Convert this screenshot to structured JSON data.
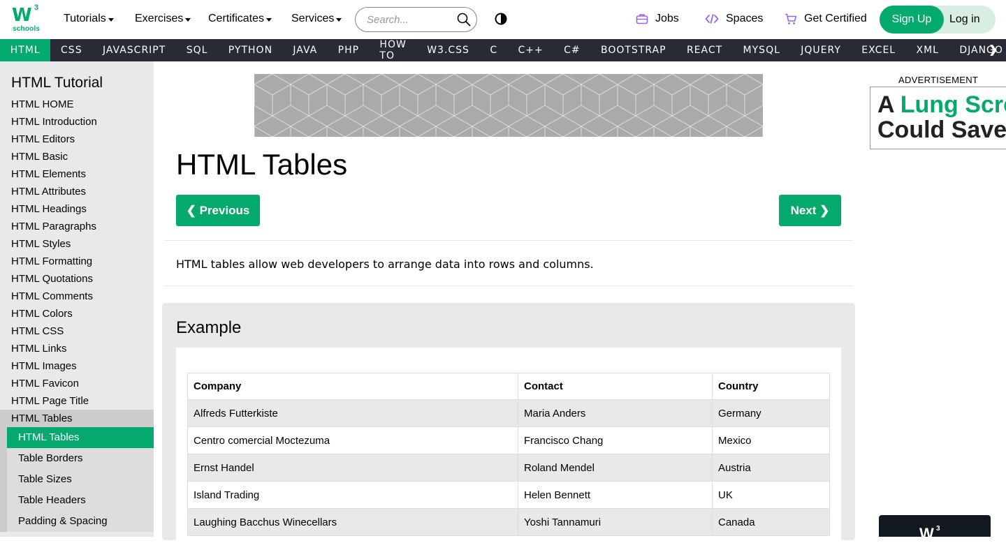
{
  "logo": {
    "main": "W",
    "sup": "3",
    "sub": "schools"
  },
  "topnav": {
    "tutorials": "Tutorials",
    "exercises": "Exercises",
    "certificates": "Certificates",
    "services": "Services",
    "search_placeholder": "Search...",
    "jobs": "Jobs",
    "spaces": "Spaces",
    "get_certified": "Get Certified",
    "sign_up": "Sign Up",
    "log_in": "Log in"
  },
  "subnav": [
    "HTML",
    "CSS",
    "JAVASCRIPT",
    "SQL",
    "PYTHON",
    "JAVA",
    "PHP",
    "HOW TO",
    "W3.CSS",
    "C",
    "C++",
    "C#",
    "BOOTSTRAP",
    "REACT",
    "MYSQL",
    "JQUERY",
    "EXCEL",
    "XML",
    "DJANGO"
  ],
  "subnav_more": "❯",
  "sidebar": {
    "title": "HTML Tutorial",
    "items": [
      "HTML HOME",
      "HTML Introduction",
      "HTML Editors",
      "HTML Basic",
      "HTML Elements",
      "HTML Attributes",
      "HTML Headings",
      "HTML Paragraphs",
      "HTML Styles",
      "HTML Formatting",
      "HTML Quotations",
      "HTML Comments",
      "HTML Colors",
      "HTML CSS",
      "HTML Links",
      "HTML Images",
      "HTML Favicon",
      "HTML Page Title",
      "HTML Tables"
    ],
    "subitems": [
      "HTML Tables",
      "Table Borders",
      "Table Sizes",
      "Table Headers",
      "Padding & Spacing"
    ]
  },
  "main": {
    "title": "HTML Tables",
    "prev": "❮ Previous",
    "next": "Next ❯",
    "intro": "HTML tables allow web developers to arrange data into rows and columns.",
    "example_title": "Example",
    "table": {
      "headers": [
        "Company",
        "Contact",
        "Country"
      ],
      "rows": [
        [
          "Alfreds Futterkiste",
          "Maria Anders",
          "Germany"
        ],
        [
          "Centro comercial Moctezuma",
          "Francisco Chang",
          "Mexico"
        ],
        [
          "Ernst Handel",
          "Roland Mendel",
          "Austria"
        ],
        [
          "Island Trading",
          "Helen Bennett",
          "UK"
        ],
        [
          "Laughing Bacchus Winecellars",
          "Yoshi Tannamuri",
          "Canada"
        ]
      ]
    }
  },
  "ad": {
    "label": "ADVERTISEMENT",
    "line1_a": "A ",
    "line1_b": "Lung Scre",
    "line2": "Could Save",
    "bottom_logo": "W",
    "bottom_sup": "3"
  },
  "colors": {
    "accent": "#04AA6D",
    "dark": "#282A35",
    "sidebar": "#E7E9EB"
  }
}
